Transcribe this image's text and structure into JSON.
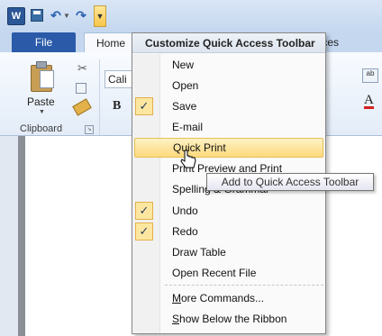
{
  "qat": {
    "word_icon": "W",
    "icons": [
      "word-logo-icon",
      "save-icon",
      "undo-icon",
      "undo-dropdown-icon",
      "redo-icon",
      "customize-qat-icon"
    ]
  },
  "tabs": {
    "file": "File",
    "home": "Home",
    "right_partial": "ences"
  },
  "ribbon": {
    "paste_label": "Paste",
    "font_name": "Cali",
    "bold_glyph": "B",
    "clipboard_group": "Clipboard",
    "font_color_glyph": "A"
  },
  "menu": {
    "title": "Customize Quick Access Toolbar",
    "items": [
      {
        "label": "New",
        "checked": false
      },
      {
        "label": "Open",
        "checked": false
      },
      {
        "label": "Save",
        "checked": true
      },
      {
        "label": "E-mail",
        "checked": false
      },
      {
        "label": "Quick Print",
        "checked": false,
        "highlighted": true
      },
      {
        "label": "Print Preview and Print",
        "checked": false
      },
      {
        "label": "Spelling & Grammar",
        "checked": false
      },
      {
        "label": "Undo",
        "checked": true
      },
      {
        "label": "Redo",
        "checked": true
      },
      {
        "label": "Draw Table",
        "checked": false
      },
      {
        "label": "Open Recent File",
        "checked": false
      }
    ],
    "more_commands_prefix": "M",
    "more_commands_rest": "ore Commands...",
    "show_below_prefix": "S",
    "show_below_rest": "how Below the Ribbon"
  },
  "tooltip": "Add to Quick Access Toolbar",
  "check_glyph": "✓",
  "colors": {
    "file_tab": "#2a5aa8",
    "highlight": "#fcd97c",
    "check_bg": "#fde7a0"
  }
}
